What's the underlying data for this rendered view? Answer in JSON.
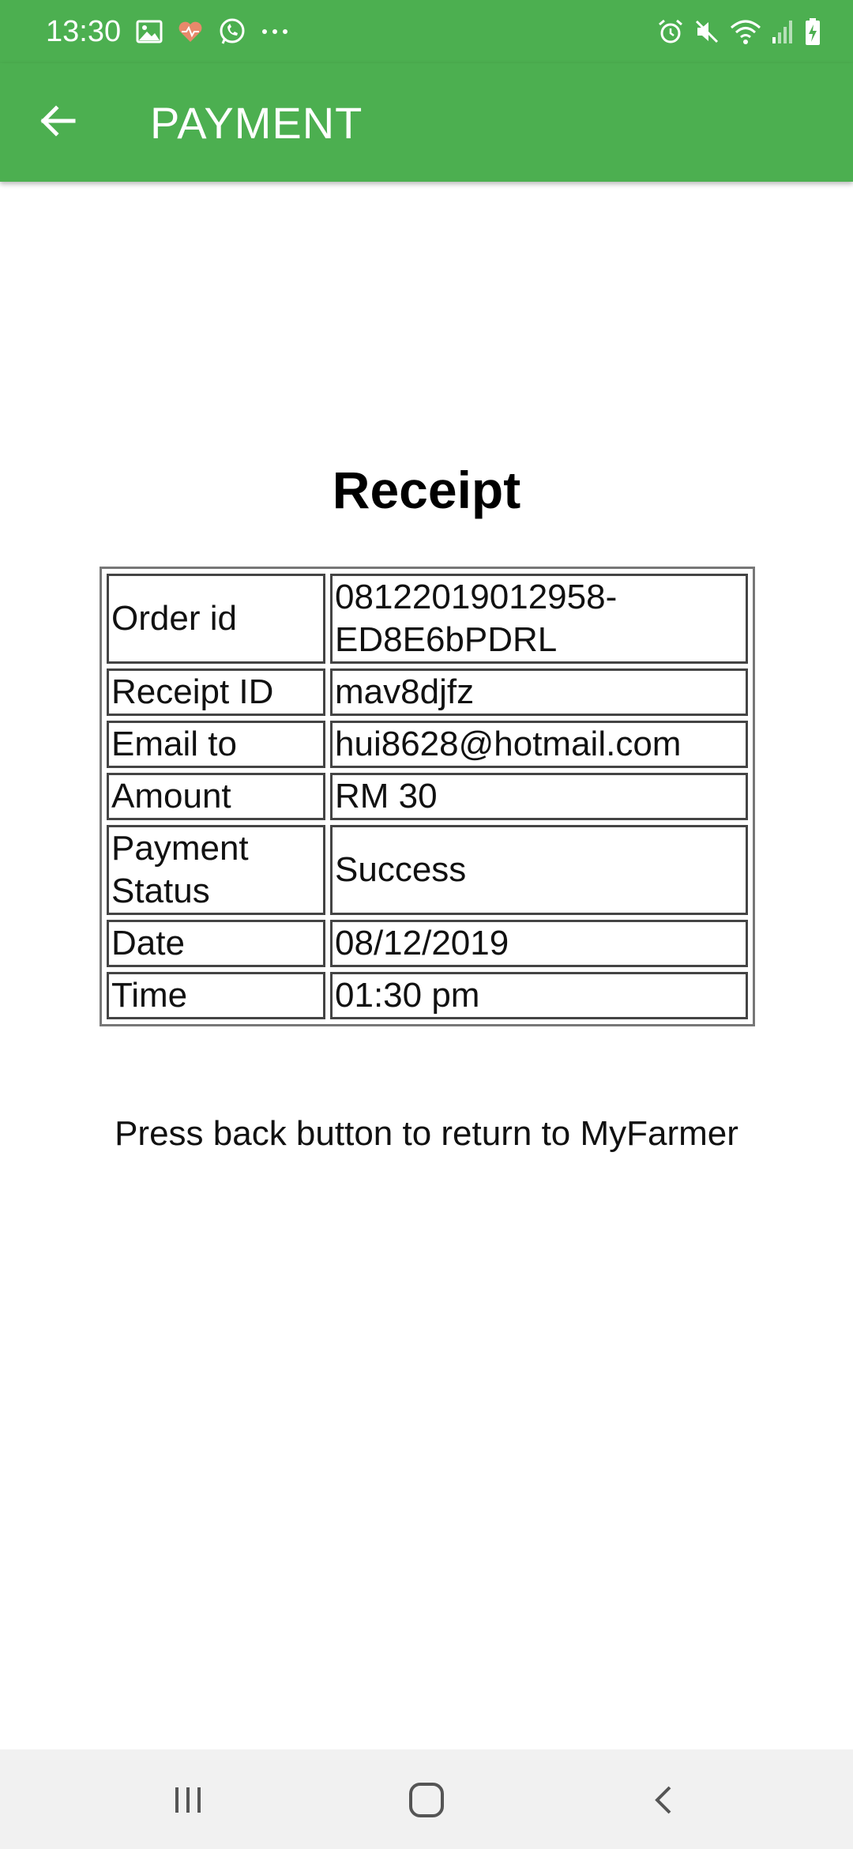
{
  "status_bar": {
    "time": "13:30",
    "left_icons": [
      "image-icon",
      "heart-monitor-icon",
      "whatsapp-icon",
      "more-dots-icon"
    ],
    "right_icons": [
      "alarm-icon",
      "mute-icon",
      "wifi-icon",
      "signal-icon",
      "battery-charging-icon"
    ]
  },
  "app_bar": {
    "title": "PAYMENT",
    "back_icon": "arrow-back-icon"
  },
  "receipt": {
    "heading": "Receipt",
    "rows": [
      {
        "label": "Order id",
        "value": "08122019012958-ED8E6bPDRL"
      },
      {
        "label": "Receipt ID",
        "value": "mav8djfz"
      },
      {
        "label": "Email to",
        "value": "hui8628@hotmail.com"
      },
      {
        "label": "Amount",
        "value": "RM 30"
      },
      {
        "label": "Payment Status",
        "value": "Success"
      },
      {
        "label": "Date",
        "value": "08/12/2019"
      },
      {
        "label": "Time",
        "value": "01:30 pm"
      }
    ],
    "note": "Press back button to return to MyFarmer"
  },
  "nav_bar": {
    "icons": [
      "recent-apps-icon",
      "home-icon",
      "back-nav-icon"
    ]
  },
  "colors": {
    "primary": "#4caf50",
    "nav_background": "#f1f1f1"
  }
}
